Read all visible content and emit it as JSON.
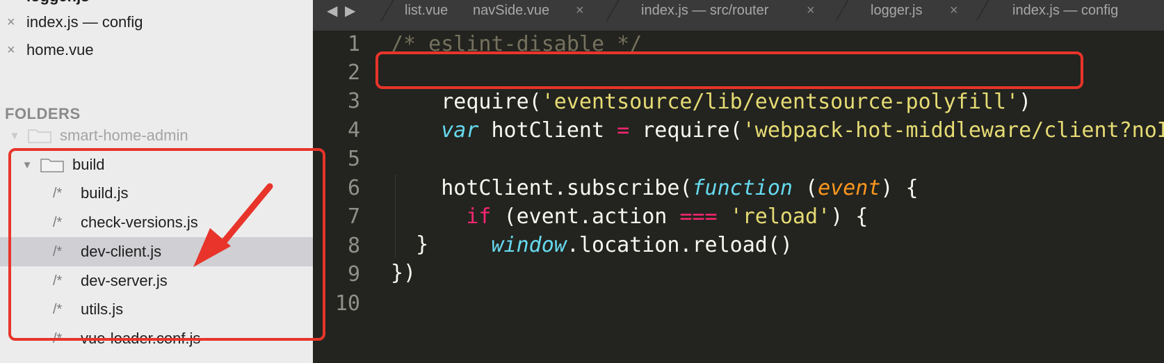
{
  "sidebar": {
    "cut_off_file": "logger.js",
    "open_files": [
      {
        "close_glyph": "×",
        "label": "index.js — config"
      },
      {
        "close_glyph": "×",
        "label": "home.vue"
      }
    ],
    "folders_header": "FOLDERS",
    "tree": [
      {
        "label": "smart-home-admin",
        "type": "folder"
      },
      {
        "label": "build",
        "type": "folder"
      },
      {
        "label": "build.js",
        "type": "file",
        "glyph": "/*"
      },
      {
        "label": "check-versions.js",
        "type": "file",
        "glyph": "/*"
      },
      {
        "label": "dev-client.js",
        "type": "file",
        "glyph": "/*",
        "selected": true
      },
      {
        "label": "dev-server.js",
        "type": "file",
        "glyph": "/*"
      },
      {
        "label": "utils.js",
        "type": "file",
        "glyph": "/*"
      },
      {
        "label": "vue-loader.conf.js",
        "type": "file",
        "glyph": "/*"
      }
    ]
  },
  "editor": {
    "nav_back": "◀",
    "nav_forward": "▶",
    "tabs": [
      {
        "label": "list.vue"
      },
      {
        "label": "navSide.vue",
        "close": "×"
      },
      {
        "label": "index.js — src/router",
        "close": "×"
      },
      {
        "label": "logger.js",
        "close": "×"
      },
      {
        "label": "index.js — config"
      }
    ],
    "line_numbers": [
      "1",
      "2",
      "3",
      "4",
      "5",
      "6",
      "7",
      "8",
      "9",
      "10"
    ],
    "code": {
      "l1": "/* eslint-disable */",
      "l2_call": "require(",
      "l2_str": "'eventsource/lib/eventsource-polyfill'",
      "l2_end": ")",
      "l3_var": "var",
      "l3_name": " hotClient ",
      "l3_eq": "=",
      "l3_call": " require(",
      "l3_str": "'webpack-hot-middleware/client?noInfo=true&reload=true'",
      "l5_a": "hotClient.subscribe(",
      "l5_fn": "function",
      "l5_b": " (",
      "l5_param": "event",
      "l5_c": ") {",
      "l6_indent": "  ",
      "l6_if": "if",
      "l6_a": " (event.action ",
      "l6_op": "===",
      "l6_sp": " ",
      "l6_str": "'reload'",
      "l6_b": ") {",
      "l7_indent": "    ",
      "l7_win": "window",
      "l7_rest": ".location.reload()",
      "l8": "  }",
      "l9": "})"
    }
  },
  "colors": {
    "annotation": "#e8342a",
    "editor_bg": "#23241f",
    "keyword": "#f92672",
    "string": "#e6db74",
    "function": "#66d9ef",
    "param": "#fd971f"
  }
}
